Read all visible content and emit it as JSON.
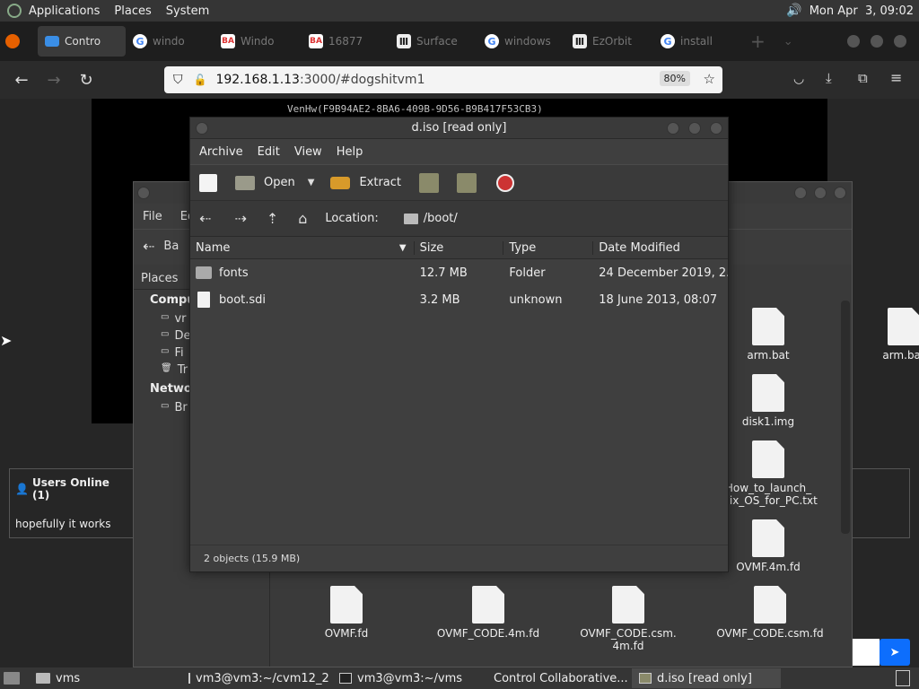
{
  "top_panel": {
    "menus": [
      "Applications",
      "Places",
      "System"
    ],
    "clock": "Mon Apr  3, 09:02"
  },
  "browser": {
    "tabs": [
      {
        "label": "Contro",
        "icon": "monitor-icon"
      },
      {
        "label": "windo",
        "icon": "google-icon"
      },
      {
        "label": "Windo",
        "icon": "ba-icon"
      },
      {
        "label": "16877",
        "icon": "ba-icon"
      },
      {
        "label": "Surface",
        "icon": "archive-icon"
      },
      {
        "label": "windows",
        "icon": "google-icon"
      },
      {
        "label": "EzOrbit",
        "icon": "archive-icon"
      },
      {
        "label": "install",
        "icon": "google-icon"
      }
    ],
    "url": "192.168.1.13:3000/#dogshitvm1",
    "url_host": "192.168.1.13",
    "url_rest": ":3000/#dogshitvm1",
    "zoom": "80%"
  },
  "vm": {
    "boot_text": "VenHw(F9B94AE2-8BA6-409B-9D56-B9B417F53CB3)"
  },
  "users_panel": {
    "title": "Users Online (1)",
    "user": "hopefully it works"
  },
  "nautilus": {
    "menu_file": "File",
    "menu_edit": "Ed",
    "back_label": "Ba",
    "places_title": "Places",
    "computer_header": "Compu",
    "items": [
      "vr",
      "De",
      "Fi",
      "Tr"
    ],
    "network_header": "Netwo",
    "network_items": [
      "Br"
    ],
    "grid_files": [
      {
        "name": "arm.bat"
      },
      {
        "name": "disk1.img"
      },
      {
        "name": "How_to_launch_\nmix_OS_for_PC.txt"
      },
      {
        "name": "OVMF.4m.fd"
      },
      {
        "name": "OVMF.fd"
      },
      {
        "name": "OVMF_CODE.4m.fd"
      },
      {
        "name": "OVMF_CODE.csm.\n4m.fd"
      },
      {
        "name": "OVMF_CODE.csm.fd"
      }
    ]
  },
  "file_roller": {
    "title": "d.iso [read only]",
    "menu": [
      "Archive",
      "Edit",
      "View",
      "Help"
    ],
    "toolbar": {
      "open": "Open",
      "extract": "Extract"
    },
    "location_label": "Location:",
    "location_value": "/boot/",
    "columns": [
      "Name",
      "Size",
      "Type",
      "Date Modified"
    ],
    "rows": [
      {
        "name": "fonts",
        "size": "12.7 MB",
        "type": "Folder",
        "date": "24 December 2019, 2...",
        "icon": "folder-icon"
      },
      {
        "name": "boot.sdi",
        "size": "3.2 MB",
        "type": "unknown",
        "date": "18 June 2013, 08:07",
        "icon": "file-icon"
      }
    ],
    "status": "2 objects (15.9 MB)"
  },
  "taskbar": {
    "items": [
      {
        "label": "vms",
        "icon": "folder-icon"
      },
      {
        "label": "vm3@vm3:~/cvm12_2",
        "icon": "terminal-icon"
      },
      {
        "label": "vm3@vm3:~/vms",
        "icon": "terminal-icon"
      },
      {
        "label": "Control Collaborative...",
        "icon": "firefox-icon"
      },
      {
        "label": "d.iso [read only]",
        "icon": "archive-icon"
      }
    ]
  }
}
